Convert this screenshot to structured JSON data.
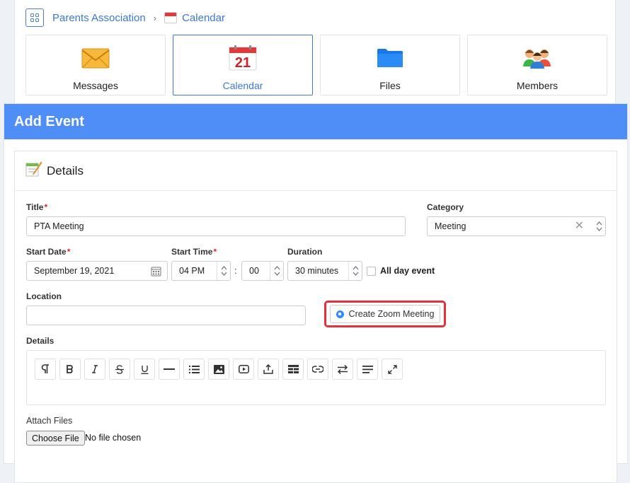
{
  "breadcrumb": {
    "group": "Parents Association",
    "separator": "›",
    "current": "Calendar"
  },
  "tiles": [
    {
      "label": "Messages",
      "icon": "envelope-icon",
      "active": false
    },
    {
      "label": "Calendar",
      "icon": "calendar-icon",
      "active": true,
      "day": "21"
    },
    {
      "label": "Files",
      "icon": "folder-icon",
      "active": false
    },
    {
      "label": "Members",
      "icon": "people-icon",
      "active": false
    }
  ],
  "page": {
    "title": "Add Event"
  },
  "card": {
    "title": "Details"
  },
  "form": {
    "title_label": "Title",
    "title_value": "PTA Meeting",
    "category_label": "Category",
    "category_value": "Meeting",
    "start_date_label": "Start Date",
    "start_date_value": "September 19, 2021",
    "start_time_label": "Start Time",
    "hour_value": "04 PM",
    "time_separator": ":",
    "minute_value": "00",
    "duration_label": "Duration",
    "duration_value": "30 minutes",
    "all_day_label": "All day event",
    "location_label": "Location",
    "location_value": "",
    "zoom_button_label": "Create Zoom Meeting",
    "details_label": "Details",
    "attach_label": "Attach Files",
    "choose_file_label": "Choose File",
    "no_file_text": "No file chosen",
    "required_mark": "*"
  },
  "toolbar_icons": [
    "paragraph-icon",
    "bold-icon",
    "italic-icon",
    "strikethrough-icon",
    "underline-icon",
    "horizontal-rule-icon",
    "list-icon",
    "image-icon",
    "video-icon",
    "upload-icon",
    "table-icon",
    "link-icon",
    "swap-icon",
    "align-icon",
    "fullscreen-icon"
  ],
  "colors": {
    "header": "#4f8ef7",
    "link": "#3b78d8",
    "required": "#e0243a",
    "highlight": "#e8303a",
    "zoom": "#2d8cff"
  }
}
